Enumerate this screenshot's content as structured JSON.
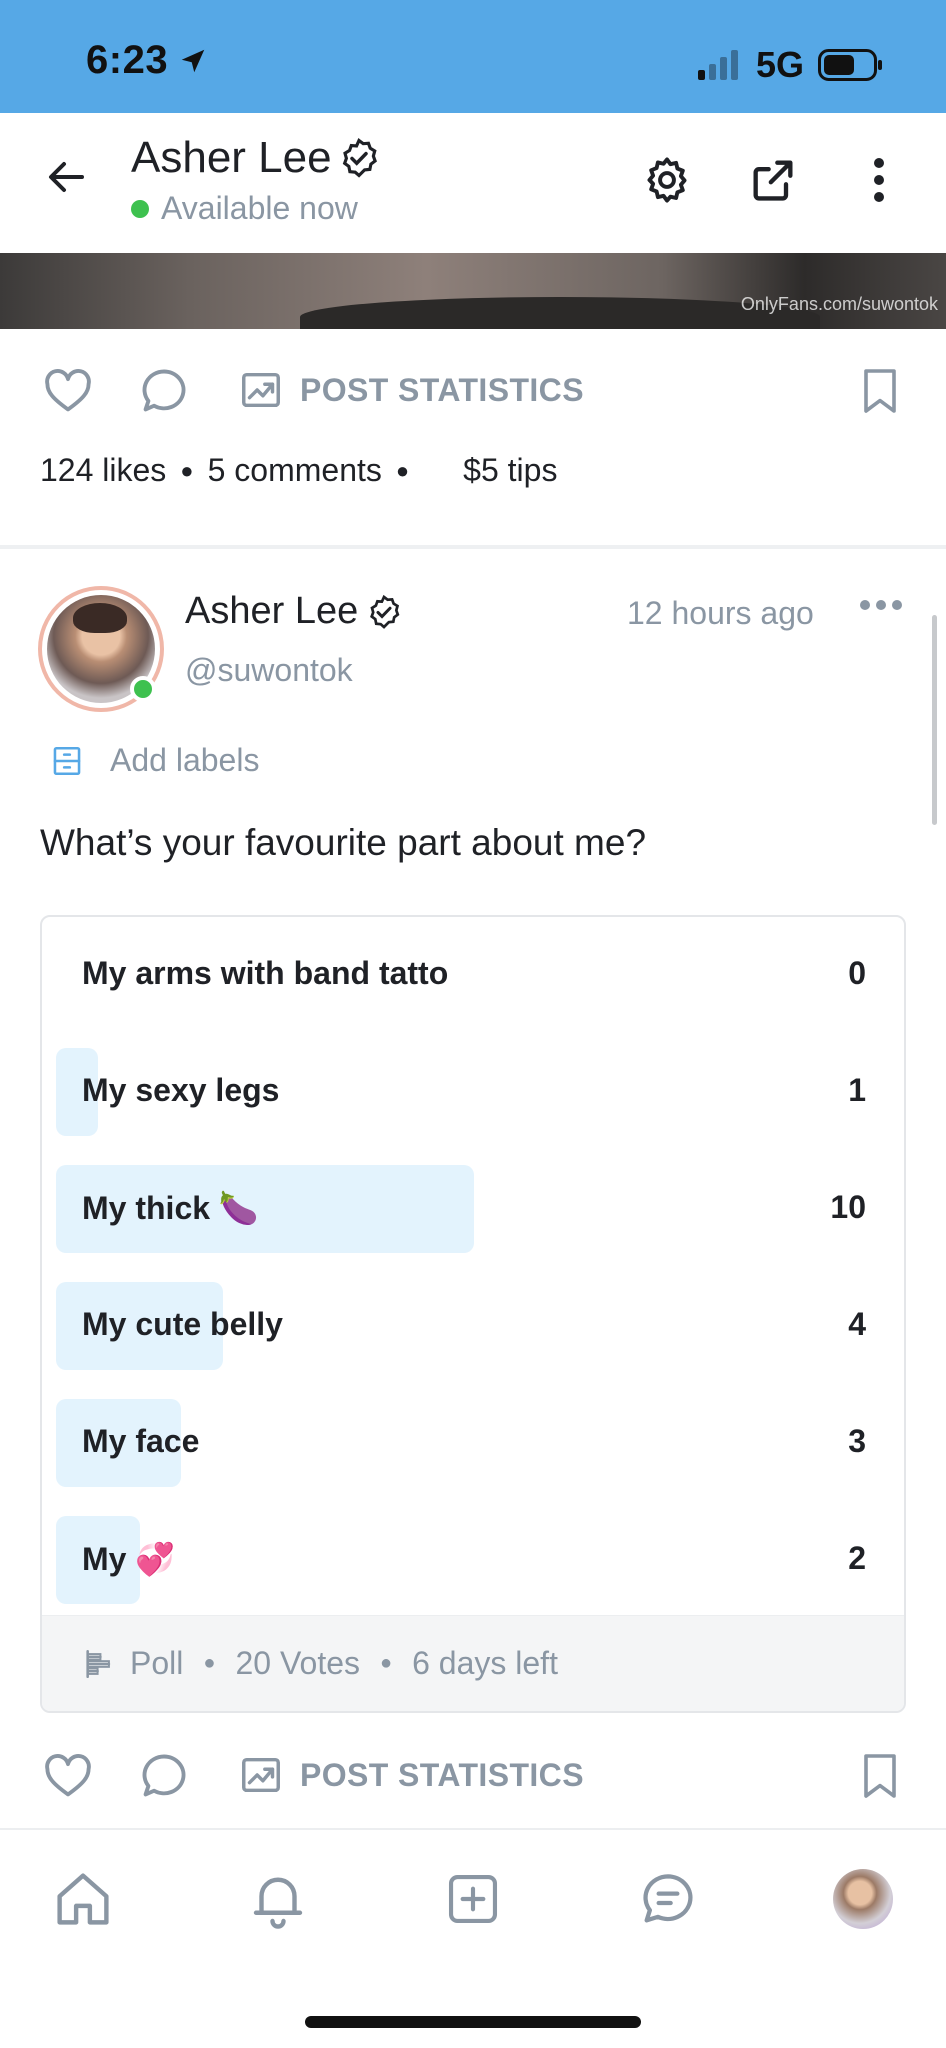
{
  "status_bar": {
    "time": "6:23",
    "network": "5G"
  },
  "header": {
    "name": "Asher Lee",
    "status": "Available now"
  },
  "media": {
    "watermark": "OnlyFans.com/suwontok"
  },
  "post1": {
    "stats_label": "POST STATISTICS",
    "likes": "124 likes",
    "comments": "5 comments",
    "tips": "$5 tips"
  },
  "post2": {
    "name": "Asher Lee",
    "handle": "@suwontok",
    "time": "12 hours ago",
    "add_labels": "Add labels",
    "text": "What’s your favourite part about me?",
    "poll": {
      "options": [
        {
          "label": "My arms with band tatto",
          "count": "0",
          "fraction": 0.0
        },
        {
          "label": "My sexy legs",
          "count": "1",
          "fraction": 0.05
        },
        {
          "label": "My thick 🍆",
          "count": "10",
          "fraction": 0.5
        },
        {
          "label": "My cute belly",
          "count": "4",
          "fraction": 0.2
        },
        {
          "label": "My face",
          "count": "3",
          "fraction": 0.15
        },
        {
          "label": "My 💞",
          "count": "2",
          "fraction": 0.1
        }
      ],
      "footer": {
        "type": "Poll",
        "votes": "20 Votes",
        "remaining": "6 days left"
      }
    },
    "stats_label": "POST STATISTICS"
  },
  "colors": {
    "status_bar": "#56a8e6",
    "accent": "#00aff0",
    "muted": "#8a96a3",
    "poll_fill": "#e3f3fd",
    "online": "#3ec14f"
  },
  "icons": [
    "back-arrow-icon",
    "verified-badge-icon",
    "settings-gear-icon",
    "share-icon",
    "more-vertical-icon",
    "heart-icon",
    "comment-icon",
    "statistics-icon",
    "bookmark-icon",
    "more-horizontal-icon",
    "label-icon",
    "poll-icon",
    "home-icon",
    "bell-icon",
    "add-icon",
    "messages-icon"
  ]
}
